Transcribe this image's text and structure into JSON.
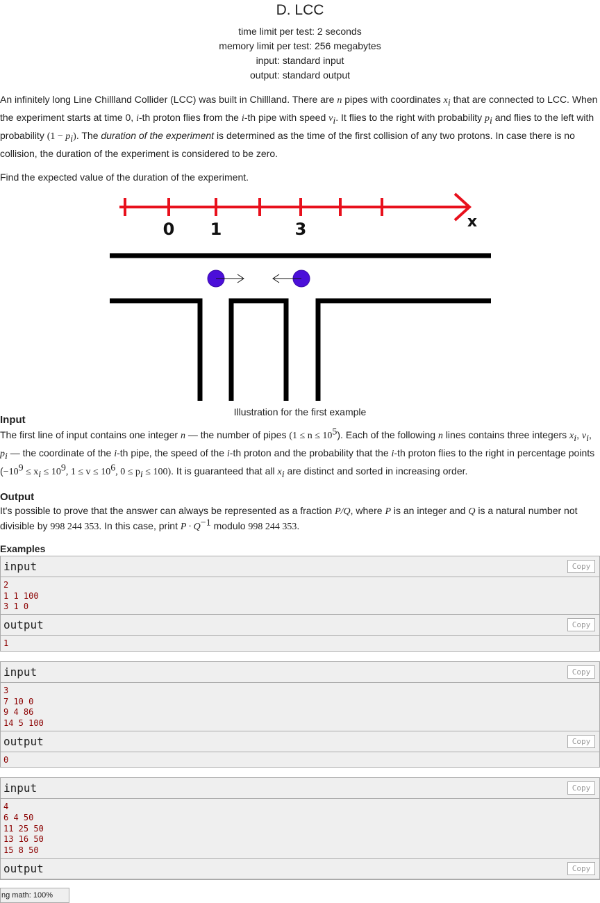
{
  "problem": {
    "title": "D. LCC",
    "limits": [
      "time limit per test: 2 seconds",
      "memory limit per test: 256 megabytes",
      "input: standard input",
      "output: standard output"
    ]
  },
  "statement": {
    "p1a": "An infinitely long Line Chillland Collider (LCC) was built in Chillland. There are",
    "n": "n",
    "p1b": "pipes with coordinates",
    "x": "x",
    "i": "i",
    "p1c": "that are connected to LCC. When the experiment starts at time 0,",
    "p1d": "-th proton flies from the",
    "p1e": "-th pipe with speed",
    "v": "v",
    "p1f": ". It flies to the right with probability",
    "p": "p",
    "p1g": "and flies to the left with probability",
    "prob_left_open": "(1 − ",
    "prob_left_close": ")",
    "p1h": ". The",
    "duration_em": "duration of the experiment",
    "p1i": "is determined as the time of the first collision of any two protons. In case there is no collision, the duration of the experiment is considered to be zero.",
    "p2": "Find the expected value of the duration of the experiment."
  },
  "illustration": {
    "axis_labels": [
      "0",
      "1",
      "3"
    ],
    "axis_x": "x",
    "caption": "Illustration for the first example"
  },
  "input_section": {
    "title": "Input",
    "t1": "The first line of input contains one integer",
    "t2": "— the number of pipes",
    "constraint_n": "(1 ≤ n ≤ 10",
    "exp5": "5",
    "t3": "). Each of the following",
    "t4": "lines contains three integers",
    "t5": "— the coordinate of the",
    "t6": "-th pipe, the speed of the",
    "t7": "-th proton and the probability that the",
    "t8": "-th proton flies to the right in percentage points (",
    "c1": "−10",
    "exp9": "9",
    "c2": " ≤ x",
    "c3": " ≤ 10",
    "c4": ", 1 ≤ v ≤ 10",
    "exp6": "6",
    "c5": ", 0 ≤ p",
    "c6": " ≤ 100)",
    "t9": ". It is guaranteed that all",
    "t10": "are distinct and sorted in increasing order."
  },
  "output_section": {
    "title": "Output",
    "t1": "It's possible to prove that the answer can always be represented as a fraction",
    "frac": "P/Q",
    "t2": ", where",
    "P": "P",
    "t3": "is an integer and",
    "Q": "Q",
    "t4": "is a natural number not divisible by",
    "mod": "998 244 353",
    "t5": ". In this case, print",
    "expr": "P · Q",
    "exp_neg1": "−1",
    "t6": "modulo",
    "t7": "."
  },
  "examples": {
    "title": "Examples",
    "input_label": "input",
    "output_label": "output",
    "copy_label": "Copy",
    "samples": [
      {
        "input": "2\n1 1 100\n3 1 0",
        "output": "1"
      },
      {
        "input": "3\n7 10 0\n9 4 86\n14 5 100",
        "output": "0"
      },
      {
        "input": "4\n6 4 50\n11 25 50\n13 16 50\n15 8 50",
        "output": ""
      }
    ]
  },
  "status_bar": {
    "text": "ng math: 100%"
  }
}
